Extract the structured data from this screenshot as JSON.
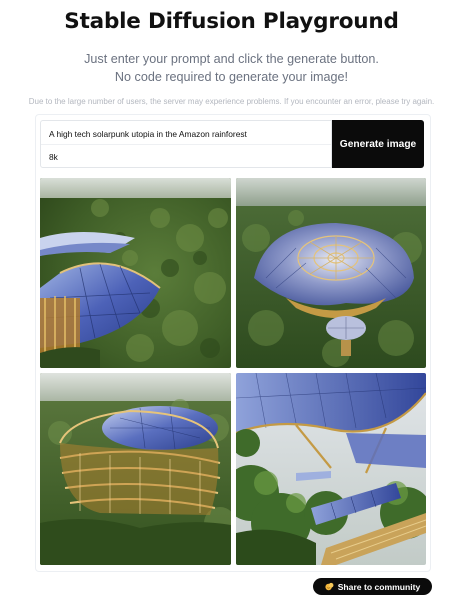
{
  "header": {
    "title": "Stable Diffusion Playground",
    "subtitle_line1": "Just enter your prompt and click the generate button.",
    "subtitle_line2": "No code required to generate your image!",
    "notice": "Due to the large number of users, the server may experience problems. If you encounter an error, please try again."
  },
  "form": {
    "prompt": "A high tech solarpunk utopia in the Amazon rainforest",
    "negative_value": "8k",
    "generate_label": "Generate image"
  },
  "gallery": {
    "images": [
      {
        "icon": "generated-image"
      },
      {
        "icon": "generated-image"
      },
      {
        "icon": "generated-image"
      },
      {
        "icon": "generated-image"
      }
    ]
  },
  "footer": {
    "share_label": "Share to community",
    "share_icon": "community-icon"
  },
  "colors": {
    "button_bg": "#0b0b0b",
    "title": "#111111",
    "subtitle": "#6b7280",
    "notice": "#b3b7bf"
  }
}
